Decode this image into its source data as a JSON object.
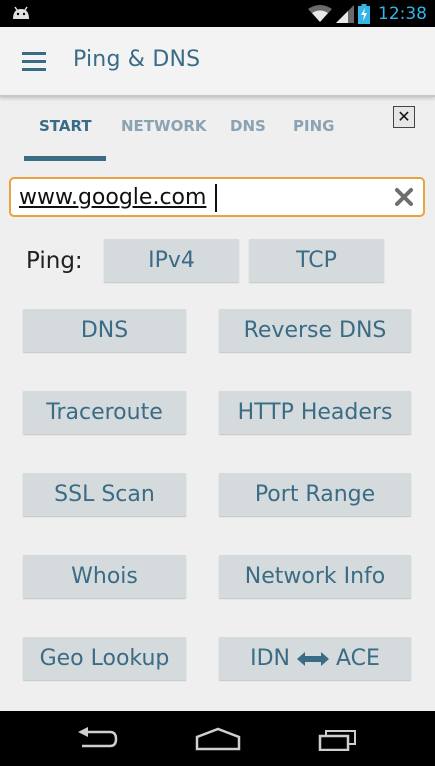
{
  "status_bar": {
    "time": "12:38",
    "icons": [
      "android-icon",
      "wifi-icon",
      "signal-icon",
      "battery-charging-icon"
    ]
  },
  "app_bar": {
    "title": "Ping & DNS",
    "menu_icon": "hamburger-menu-icon"
  },
  "tabs": [
    {
      "label": "START",
      "active": true
    },
    {
      "label": "NETWORK",
      "active": false
    },
    {
      "label": "DNS",
      "active": false
    },
    {
      "label": "PING",
      "active": false
    }
  ],
  "close_icon": "close-icon",
  "host_input": {
    "value": "www.google.com",
    "clear_icon": "clear-x-icon"
  },
  "ping": {
    "label": "Ping:",
    "buttons": [
      "IPv4",
      "TCP"
    ]
  },
  "tools": [
    {
      "left": "DNS",
      "right": "Reverse DNS"
    },
    {
      "left": "Traceroute",
      "right": "HTTP Headers"
    },
    {
      "left": "SSL Scan",
      "right": "Port Range"
    },
    {
      "left": "Whois",
      "right": "Network Info"
    },
    {
      "left": "Geo Lookup",
      "right_prefix": "IDN",
      "right_suffix": "ACE"
    }
  ],
  "nav_bar": {
    "icons": [
      "back-icon",
      "home-icon",
      "recent-apps-icon"
    ]
  },
  "colors": {
    "accent": "#3a6c86",
    "button_bg": "#d5dadc",
    "input_border": "#e9a43c",
    "status_time": "#33b5e5"
  }
}
